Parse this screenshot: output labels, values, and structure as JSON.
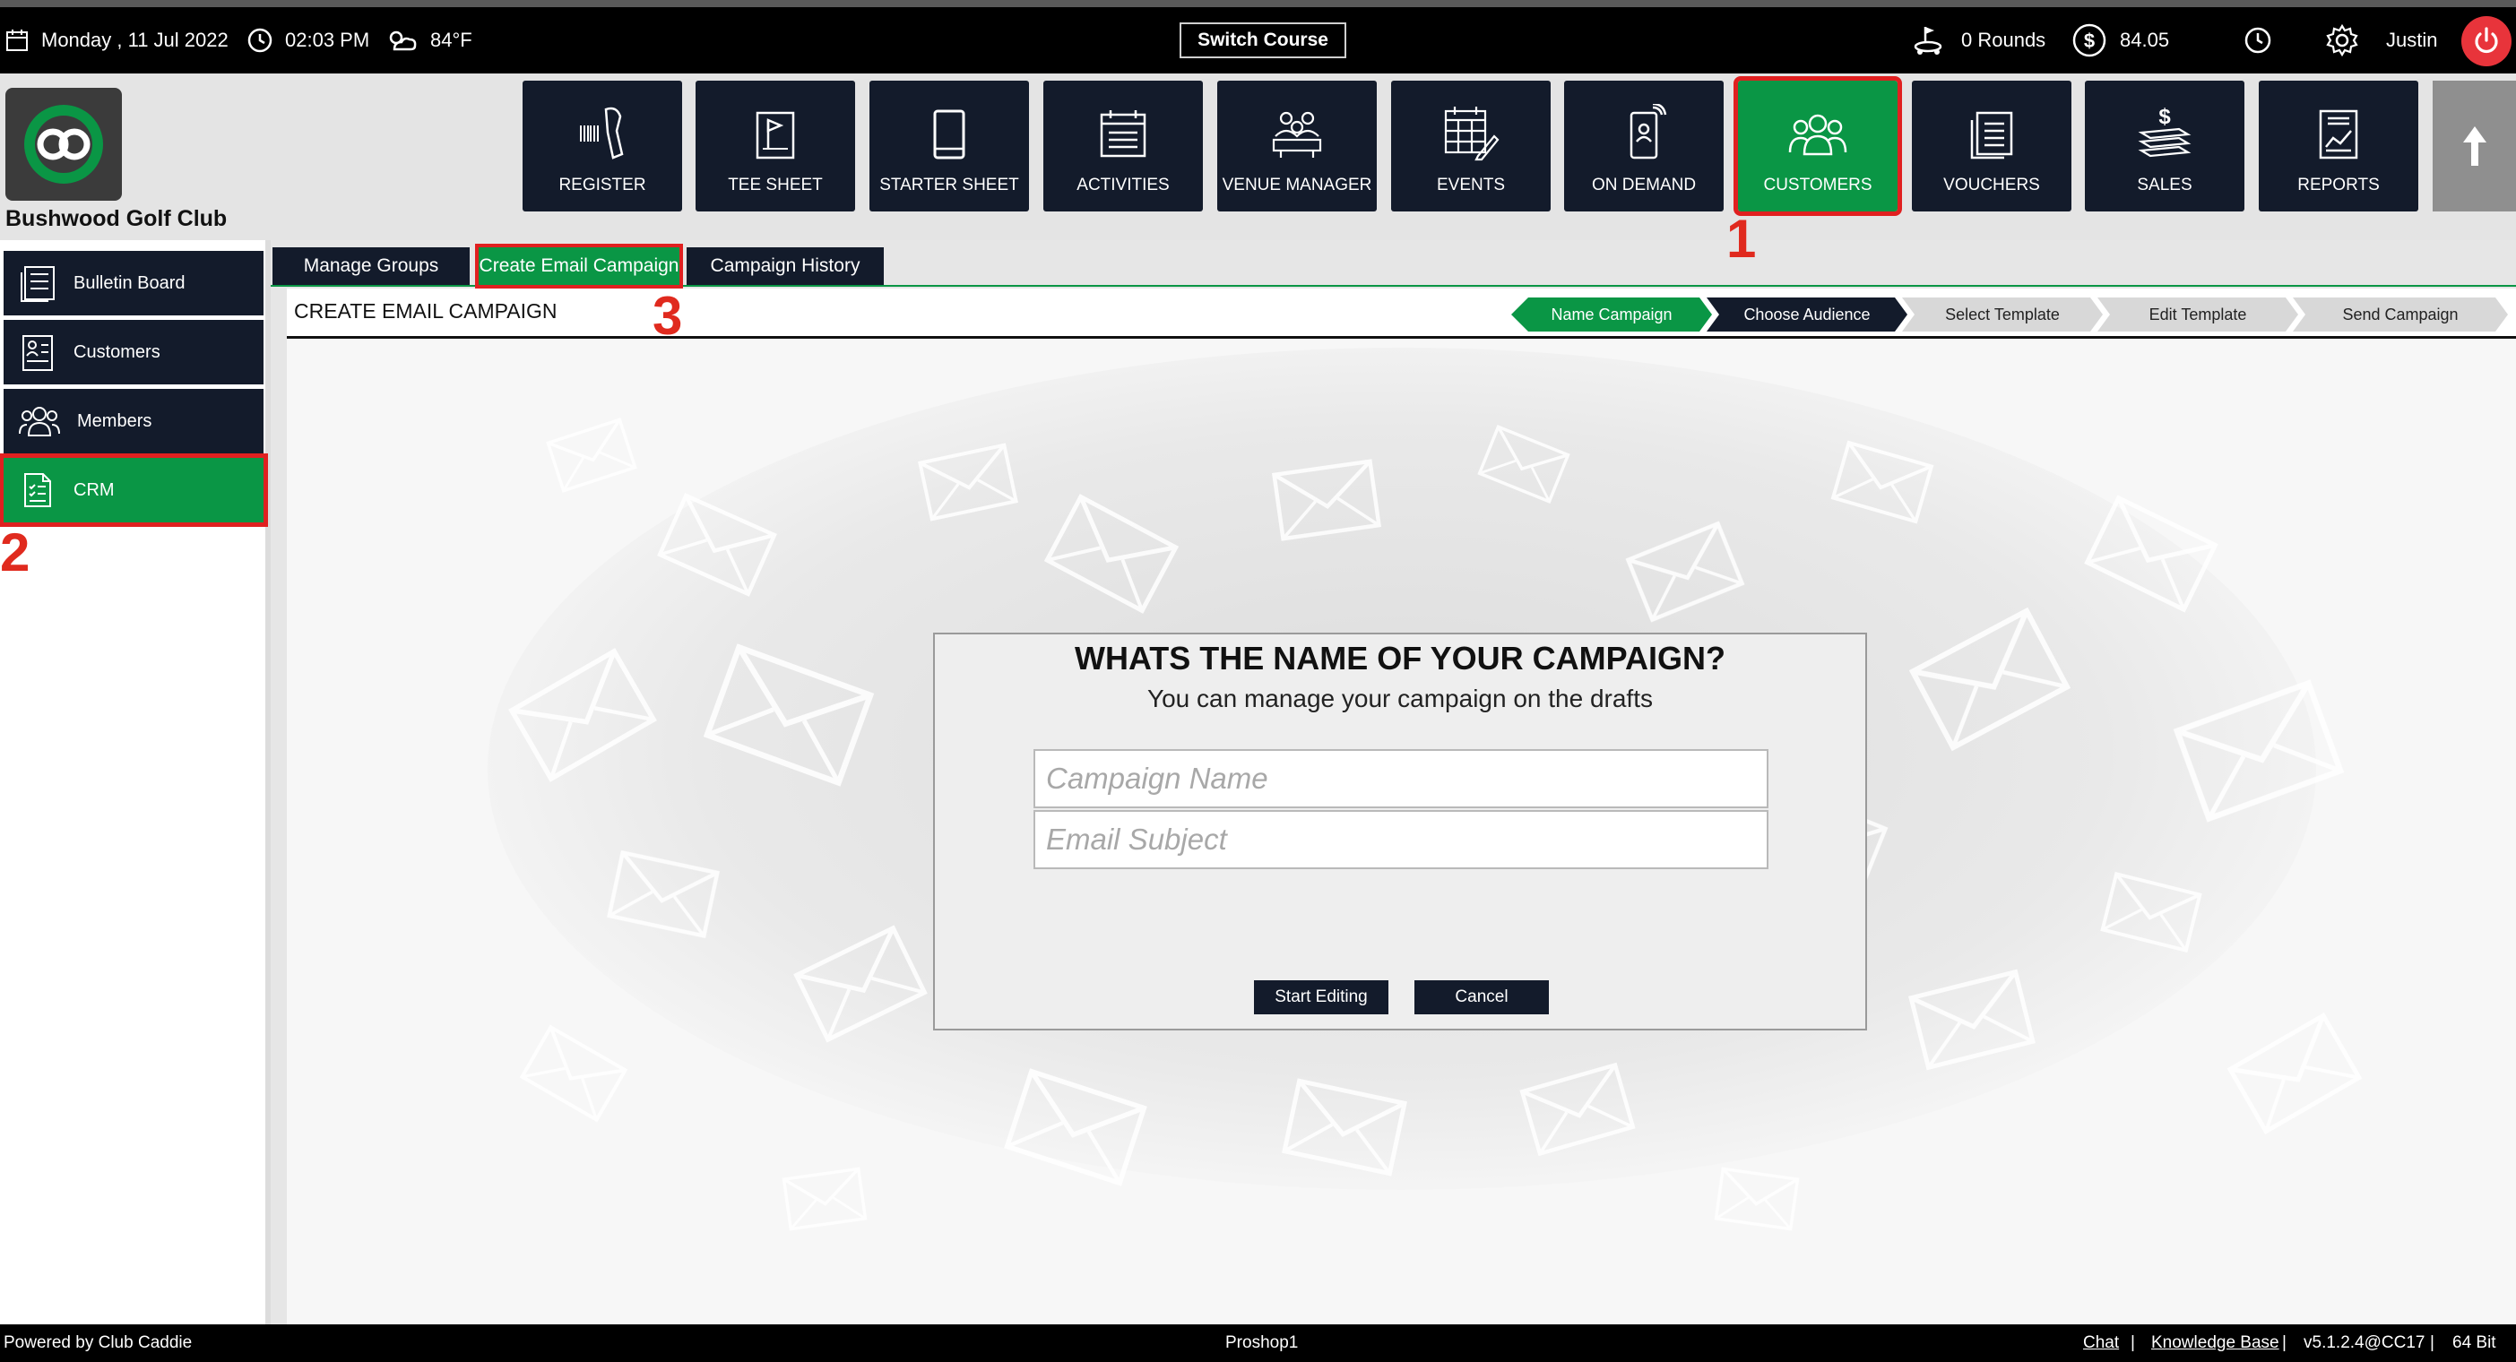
{
  "topbar": {
    "date": "Monday ,  11 Jul 2022",
    "time": "02:03 PM",
    "weather": "84°F",
    "switch_course": "Switch Course",
    "rounds": "0 Rounds",
    "balance": "84.05",
    "user": "Justin"
  },
  "header": {
    "club_name": "Bushwood Golf Club",
    "nav": [
      {
        "label": "REGISTER",
        "icon": "barcode-scanner-icon"
      },
      {
        "label": "TEE SHEET",
        "icon": "flag-sheet-icon"
      },
      {
        "label": "STARTER SHEET",
        "icon": "tablet-icon"
      },
      {
        "label": "ACTIVITIES",
        "icon": "calendar-list-icon"
      },
      {
        "label": "VENUE MANAGER",
        "icon": "group-table-icon"
      },
      {
        "label": "EVENTS",
        "icon": "calendar-edit-icon"
      },
      {
        "label": "ON DEMAND",
        "icon": "mobile-person-icon"
      },
      {
        "label": "CUSTOMERS",
        "icon": "people-icon"
      },
      {
        "label": "VOUCHERS",
        "icon": "document-stack-icon"
      },
      {
        "label": "SALES",
        "icon": "money-stack-icon"
      },
      {
        "label": "REPORTS",
        "icon": "report-chart-icon"
      }
    ],
    "active_nav": "CUSTOMERS"
  },
  "annotations": [
    "1",
    "2",
    "3"
  ],
  "sidebar": {
    "items": [
      {
        "label": "Bulletin Board",
        "icon": "bulletin-board-icon"
      },
      {
        "label": "Customers",
        "icon": "customer-card-icon"
      },
      {
        "label": "Members",
        "icon": "members-icon"
      },
      {
        "label": "CRM",
        "icon": "crm-document-icon"
      }
    ],
    "active": "CRM"
  },
  "subtabs": [
    "Manage Groups",
    "Create Email Campaign",
    "Campaign History"
  ],
  "page": {
    "title": "CREATE EMAIL CAMPAIGN",
    "steps": [
      "Name Campaign",
      "Choose Audience",
      "Select Template",
      "Edit Template",
      "Send Campaign"
    ]
  },
  "dialog": {
    "title": "WHATS THE NAME OF YOUR CAMPAIGN?",
    "subtitle": "You can manage your campaign on the drafts",
    "campaign_name_placeholder": "Campaign Name",
    "email_subject_placeholder": "Email Subject",
    "start_label": "Start Editing",
    "cancel_label": "Cancel"
  },
  "footer": {
    "powered_by": "Powered by Club Caddie",
    "station": "Proshop1",
    "chat": "Chat",
    "separator": "|",
    "knowledge_base": "Knowledge Base",
    "version": "v5.1.2.4@CC17",
    "bits": "64 Bit"
  },
  "colors": {
    "nav_bg": "#131b2b",
    "active_green": "#0a9645",
    "annotation_red": "#e02020",
    "power_red": "#e8343b"
  }
}
